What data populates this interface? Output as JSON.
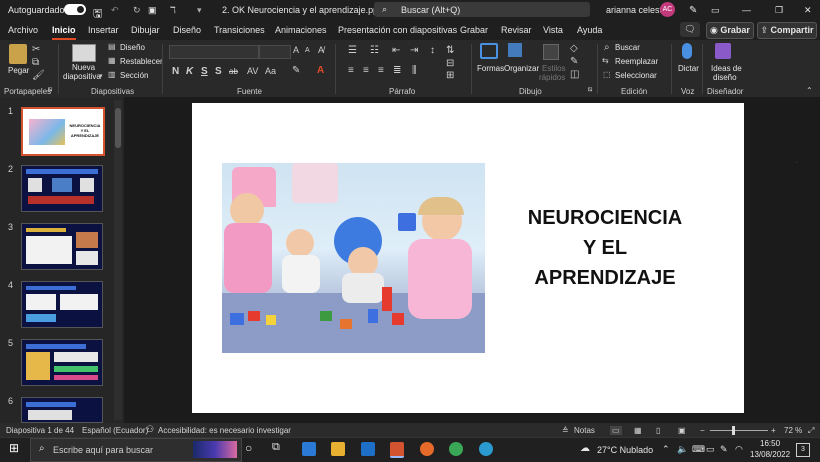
{
  "titlebar": {
    "autosave_label": "Autoguardado",
    "file_name": "2. OK Neurociencia y el aprendizaje.pptx",
    "search_placeholder": "Buscar (Alt+Q)",
    "user_name": "arianna celeste",
    "user_initials": "AC"
  },
  "tabs": [
    "Archivo",
    "Inicio",
    "Insertar",
    "Dibujar",
    "Diseño",
    "Transiciones",
    "Animaciones",
    "Presentación con diapositivas",
    "Grabar",
    "Revisar",
    "Vista",
    "Ayuda"
  ],
  "tab_buttons": {
    "record": "Grabar",
    "share": "Compartir"
  },
  "ribbon": {
    "groups": {
      "clipboard": "Portapapeles",
      "slides": "Diapositivas",
      "font": "Fuente",
      "paragraph": "Párrafo",
      "drawing": "Dibujo",
      "editing": "Edición",
      "voice": "Voz",
      "designer": "Diseñador"
    },
    "paste": "Pegar",
    "new_slide_1": "Nueva",
    "new_slide_2": "diapositiva",
    "layout": "Diseño",
    "reset": "Restablecer",
    "section": "Sección",
    "font_letters": [
      "N",
      "K",
      "S",
      "S",
      "ab"
    ],
    "shapes": "Formas",
    "arrange": "Organizar",
    "quick_styles_1": "Estilos",
    "quick_styles_2": "rápidos",
    "find": "Buscar",
    "replace": "Reemplazar",
    "select": "Seleccionar",
    "dictate": "Dictar",
    "design_ideas_1": "Ideas de",
    "design_ideas_2": "diseño"
  },
  "thumbnails": [
    {
      "num": "1",
      "title_lines": [
        "NEUROCIENCIA",
        "Y EL",
        "APRENDIZAJE"
      ]
    },
    {
      "num": "2"
    },
    {
      "num": "3"
    },
    {
      "num": "4"
    },
    {
      "num": "5"
    },
    {
      "num": "6"
    }
  ],
  "slide": {
    "title_lines": [
      "NEUROCIENCIA",
      "Y EL",
      "APRENDIZAJE"
    ]
  },
  "status": {
    "slide_counter": "Diapositiva 1 de 44",
    "language": "Español (Ecuador)",
    "accessibility": "Accesibilidad: es necesario investigar",
    "notes": "Notas",
    "zoom": "72 %"
  },
  "taskbar": {
    "search_placeholder": "Escribe aquí para buscar",
    "weather": "27°C  Nublado",
    "time": "16:50",
    "date": "13/08/2022",
    "notification_count": "3"
  },
  "colors": {
    "accent": "#d35230",
    "background": "#1f1f1f",
    "ribbon": "#292929",
    "slide_title": "#111111"
  }
}
